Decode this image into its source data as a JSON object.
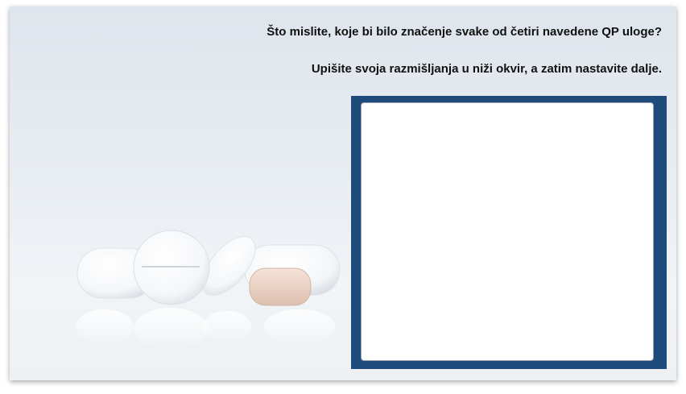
{
  "prompt": {
    "question": "Što mislite, koje bi bilo značenje svake od četiri navedene QP uloge?",
    "instruction": "Upišite svoja razmišljanja u niži okvir, a zatim nastavite dalje."
  },
  "answer": {
    "value": "",
    "placeholder": ""
  },
  "colors": {
    "frame": "#1f4a7c",
    "background": "#e4e9ef"
  },
  "illustration": {
    "icon": "pills-illustration"
  }
}
